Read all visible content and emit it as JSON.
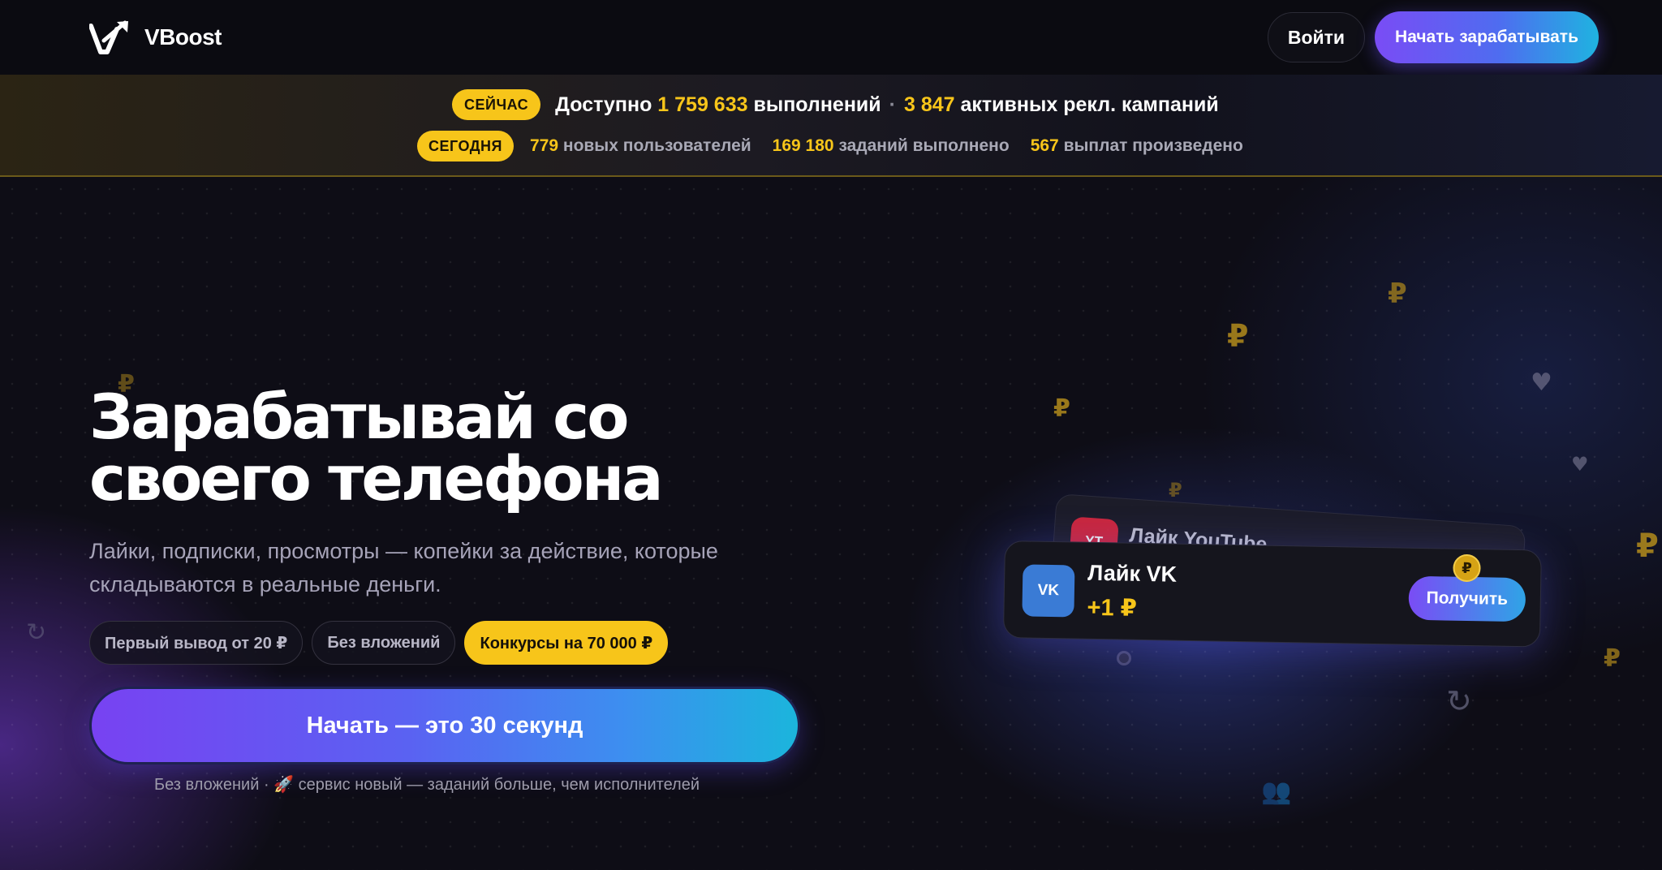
{
  "header": {
    "brand": "VBoost",
    "login_label": "Войти",
    "start_label": "Начать зарабатывать"
  },
  "stats": {
    "now_badge": "СЕЙЧАС",
    "now_prefix": "Доступно",
    "executions_count": "1 759 633",
    "executions_label": "выполнений",
    "separator": "·",
    "campaigns_count": "3 847",
    "campaigns_label": "активных рекл. кампаний",
    "today_badge": "СЕГОДНЯ",
    "new_users_count": "779",
    "new_users_label": "новых пользователей",
    "tasks_done_count": "169 180",
    "tasks_done_label": "заданий выполнено",
    "payouts_count": "567",
    "payouts_label": "выплат произведено"
  },
  "hero": {
    "title_line1": "Зарабатывай со",
    "title_line2": "своего телефона",
    "subtitle_line1": "Лайки, подписки, просмотры — копейки за действие, которые",
    "subtitle_line2": "складываются в реальные деньги.",
    "chips": [
      "Первый вывод от 20 ₽",
      "Без вложений",
      "Конкурсы на 70 000 ₽"
    ],
    "cta_label": "Начать — это 30 секунд",
    "cta_note": "Без вложений · 🚀 сервис новый — заданий больше, чем исполнителей"
  },
  "cards": {
    "back_badge": "YT",
    "back_label": "Лайк YouTube",
    "front_badge": "VK",
    "front_label": "Лайк VK",
    "front_reward": "+1 ₽",
    "get_label": "Получить",
    "coin_symbol": "₽"
  },
  "deco": {
    "ruble": "₽",
    "heart": "♥",
    "refresh": "↻",
    "people": "👥"
  },
  "colors": {
    "accent_yellow": "#f7c51a",
    "gradient_start": "#7a4cf5",
    "gradient_end": "#1fb3e0",
    "vk_blue": "#3a7bd5",
    "yt_red": "#d9283e"
  }
}
